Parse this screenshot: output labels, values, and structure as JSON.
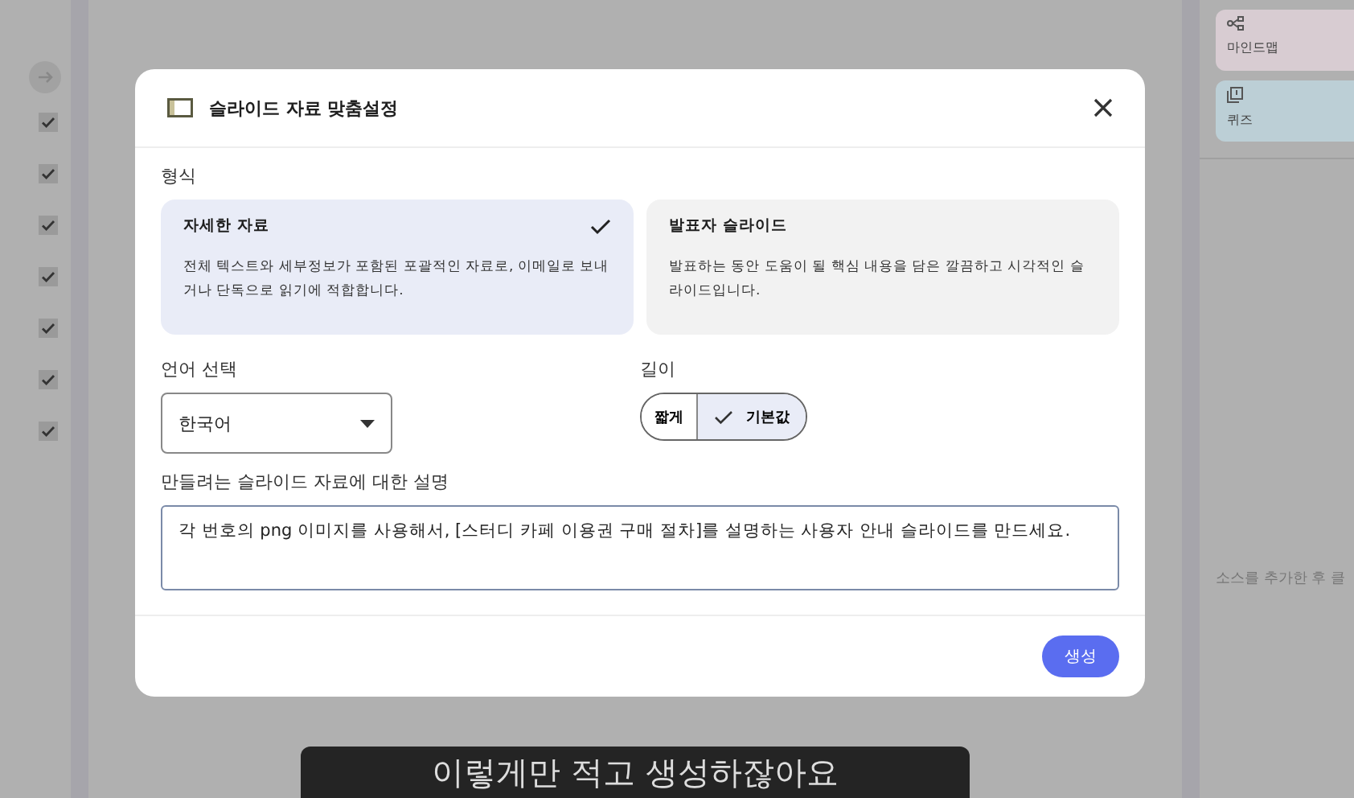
{
  "background": {
    "checkboxes": [
      {
        "checked": true
      },
      {
        "checked": true
      },
      {
        "checked": true
      },
      {
        "checked": true
      },
      {
        "checked": true
      },
      {
        "checked": true
      },
      {
        "checked": true
      }
    ],
    "right_panel": {
      "cards": [
        {
          "kind": "mindmap",
          "label": "마인드맵",
          "color": "#d8ccd2"
        },
        {
          "kind": "quiz",
          "label": "퀴즈",
          "color": "#bccfd6"
        }
      ],
      "hint": "소스를 추가한 후 클"
    },
    "caption": "이렇게만 적고 생성하잖아요"
  },
  "dialog": {
    "title": "슬라이드 자료 맞춤설정",
    "format_label": "형식",
    "formats": [
      {
        "title": "자세한 자료",
        "description": "전체 텍스트와 세부정보가 포함된 포괄적인 자료로, 이메일로 보내거나 단독으로 읽기에 적합합니다.",
        "selected": true
      },
      {
        "title": "발표자 슬라이드",
        "description": "발표하는 동안 도움이 될 핵심 내용을 담은 깔끔하고 시각적인 슬라이드입니다.",
        "selected": false
      }
    ],
    "language_label": "언어 선택",
    "language": "한국어",
    "length_label": "길이",
    "lengths": [
      {
        "label": "짧게",
        "selected": false
      },
      {
        "label": "기본값",
        "selected": true
      }
    ],
    "description_label": "만들려는 슬라이드 자료에 대한 설명",
    "description": "각 번호의 png 이미지를 사용해서, [스터디 카페 이용권 구매 절차]를 설명하는 사용자 안내 슬라이드를 만드세요.",
    "submit": "생성"
  }
}
